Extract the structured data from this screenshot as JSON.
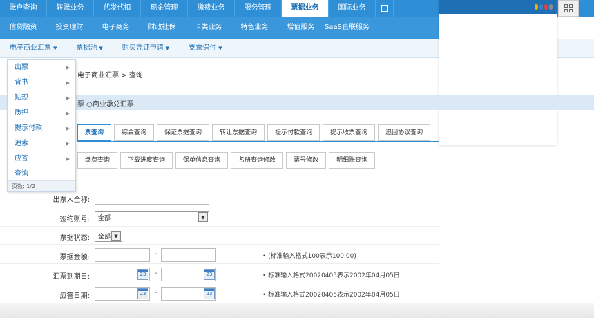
{
  "nav1": [
    "账户查询",
    "转账业务",
    "代发代扣",
    "现金管理",
    "缴费业务",
    "服务管理",
    "票据业务",
    "国际业务"
  ],
  "nav1_active": 6,
  "nav2": [
    "信贷融资",
    "投资理财",
    "电子商务",
    "财政社保",
    "卡类业务",
    "特色业务",
    "增值服务",
    "SaaS直联服务"
  ],
  "nav3": [
    "电子商业汇票",
    "票据池",
    "购买凭证申请",
    "支票保付"
  ],
  "menu": {
    "items": [
      "出票",
      "背书",
      "贴现",
      "质押",
      "提示付款",
      "追索",
      "应答",
      "查询"
    ],
    "has_arrow": [
      true,
      true,
      true,
      true,
      true,
      true,
      true,
      false
    ],
    "page": "页数: 1/2"
  },
  "breadcrumb": "电子商业汇票 > 查询",
  "type_selector": "票 ○商业承兑汇票",
  "tabs_row1": [
    "票查询",
    "综合查询",
    "保证票据查询",
    "转让票据查询",
    "提示付款查询",
    "提示收票查询",
    "追回协议查询"
  ],
  "tabs_row2": [
    "缴费查询",
    "下载进度查询",
    "保单信息查询",
    "名册查询修改",
    "票号修改",
    "明细账查询"
  ],
  "form": {
    "drawer_name_label": "出票人全称:",
    "drawer_name_value": "",
    "sign_account_label": "签约账号:",
    "sign_account_value": "全部",
    "bill_status_label": "票据状态:",
    "bill_status_value": "全部",
    "bill_amount_label": "票据金额:",
    "bill_amount_hint": "• (标准输入格式100表示100.00)",
    "due_date_label": "汇票到期日:",
    "due_date_hint": "• 标准输入格式20020405表示2002年04月05日",
    "reply_date_label": "应答日期:",
    "reply_date_hint": "• 标准输入格式20020405表示2002年04月05日",
    "dash": "-",
    "cal_num": "23"
  },
  "colors": {
    "accent": "#2f8fd6",
    "dark": "#1f6fb5"
  },
  "overlay_dots": [
    "#f0b000",
    "#3b7fc4",
    "#e04040",
    "#8a8a8a"
  ]
}
